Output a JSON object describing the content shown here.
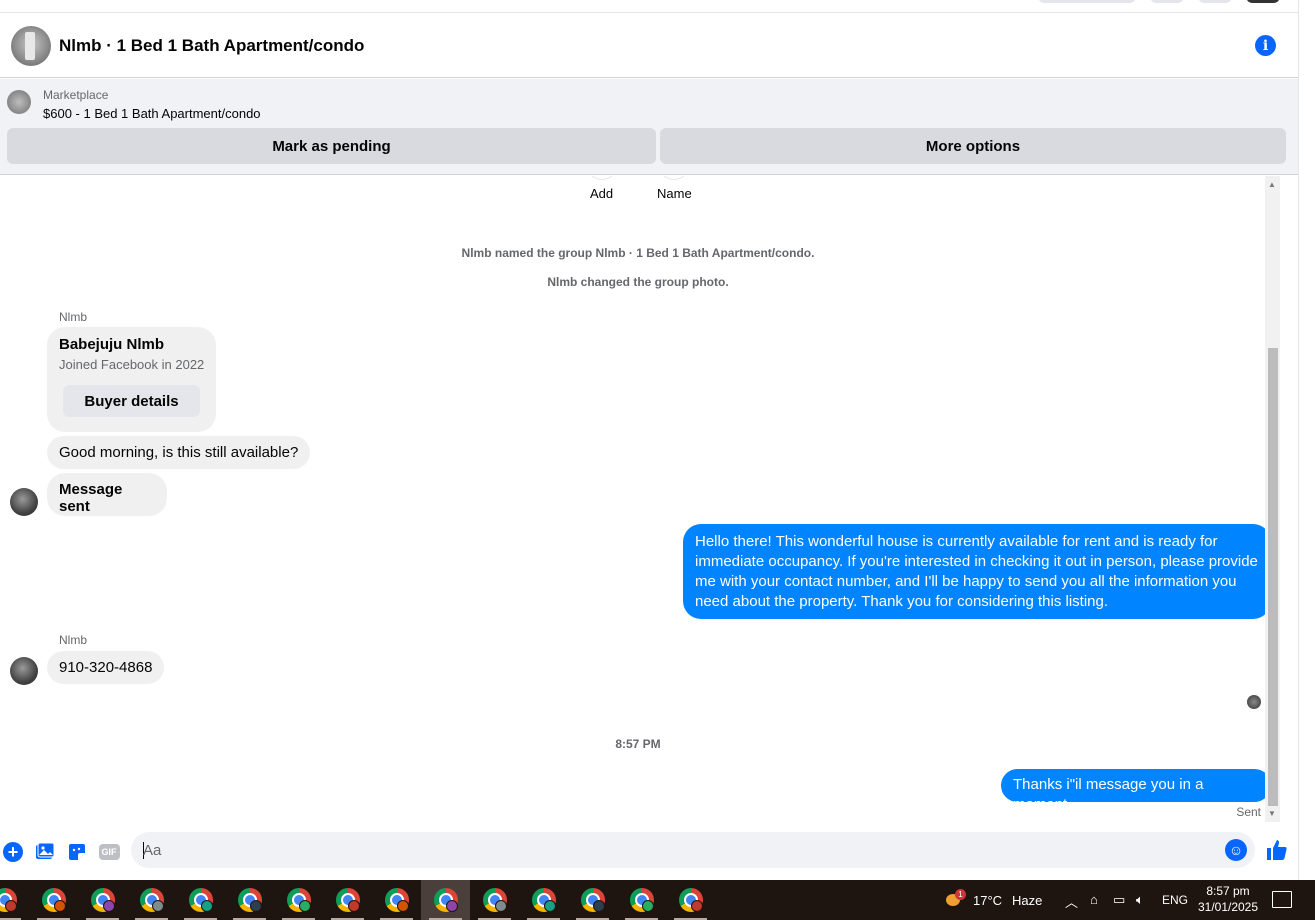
{
  "header": {
    "title": "Nlmb · 1 Bed 1 Bath Apartment/condo"
  },
  "marketplace": {
    "label": "Marketplace",
    "listing": "$600 - 1 Bed 1 Bath Apartment/condo",
    "mark_pending": "Mark as pending",
    "more_options": "More options"
  },
  "conversation": {
    "actions": [
      {
        "label": "Add"
      },
      {
        "label": "Name"
      }
    ],
    "system_messages": [
      "Nlmb named the group Nlmb · 1 Bed 1 Bath Apartment/condo.",
      "Nlmb changed the group photo."
    ],
    "buyer_card": {
      "sender": "Nlmb",
      "name": "Babejuju Nlmb",
      "joined": "Joined Facebook in 2022",
      "button": "Buyer details"
    },
    "incoming_1": "Good morning, is this still available?",
    "incoming_2": "Message sent",
    "outgoing_1": "Hello there! This wonderful house is currently available for rent and is ready for immediate occupancy. If you're interested in checking it out in person, please provide me with your contact number, and I'll be happy to send you all the information you need about the property. Thank you for considering this listing.",
    "sender_2": "Nlmb",
    "incoming_3": "910-320-4868",
    "timestamp": "8:57 PM",
    "outgoing_2": "Thanks i\"il message you in a moment",
    "sent_status": "Sent"
  },
  "composer": {
    "placeholder": "Aa",
    "gif_label": "GIF"
  },
  "taskbar": {
    "weather_badge": "1",
    "temperature": "17°C",
    "condition": "Haze",
    "language": "ENG",
    "time": "8:57 pm",
    "date": "31/01/2025",
    "app_count": 15,
    "active_app_index": 9
  },
  "colors": {
    "accent": "#0866ff",
    "outgoing_bubble": "#0084ff",
    "incoming_bubble": "#f0f0f0",
    "taskbar": "#1f1510"
  }
}
